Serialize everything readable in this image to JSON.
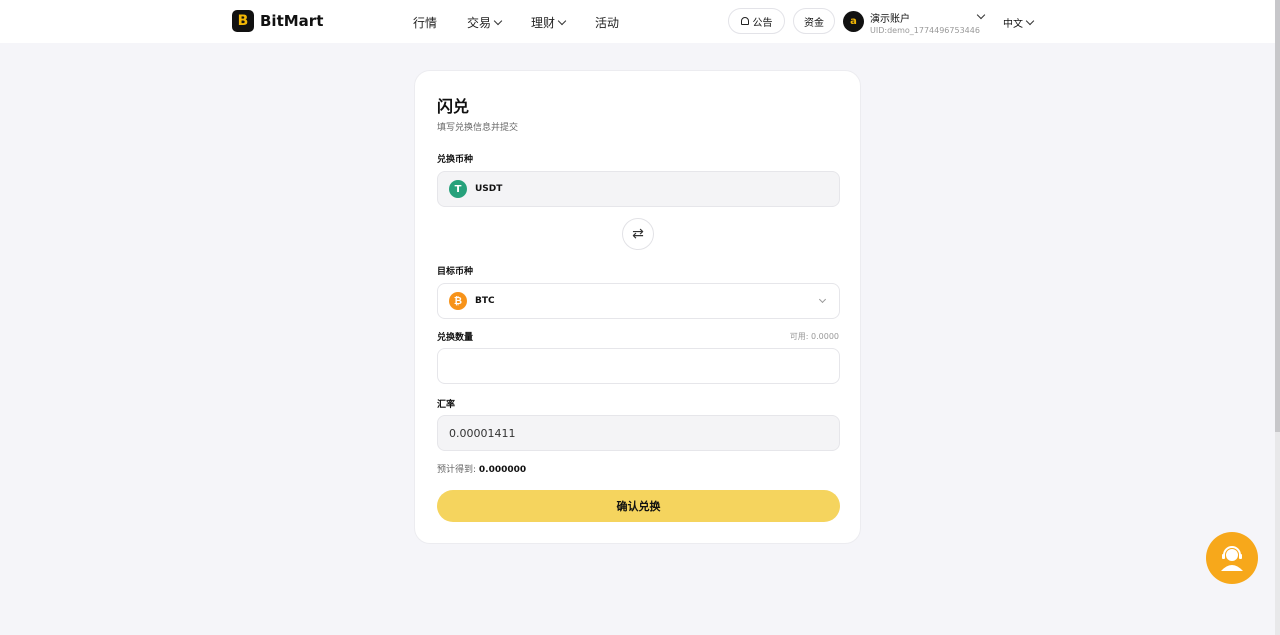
{
  "header": {
    "brand": "BitMart",
    "nav": [
      "行情",
      "交易",
      "理财",
      "活动"
    ],
    "announcement_label": "公告",
    "funds_label": "资金",
    "avatar_letter": "a",
    "account_name": "演示账户",
    "account_uid": "UID:demo_1774496753446",
    "language": "中文"
  },
  "card": {
    "title": "闪兑",
    "subtitle": "填写兑换信息并提交",
    "from_label": "兑换币种",
    "from_coin": "USDT",
    "to_label": "目标币种",
    "to_coin": "BTC",
    "amount_label": "兑换数量",
    "available": "可用: 0.0000",
    "amount_value": "",
    "rate_label": "汇率",
    "rate_value": "0.00001411",
    "estimate_label": "预计得到:",
    "estimate_value": "0.000000",
    "confirm_label": "确认兑换"
  },
  "colors": {
    "accent": "#f5d45e",
    "usdt": "#26a17b",
    "btc": "#f7931a",
    "support": "#f7a81b"
  }
}
